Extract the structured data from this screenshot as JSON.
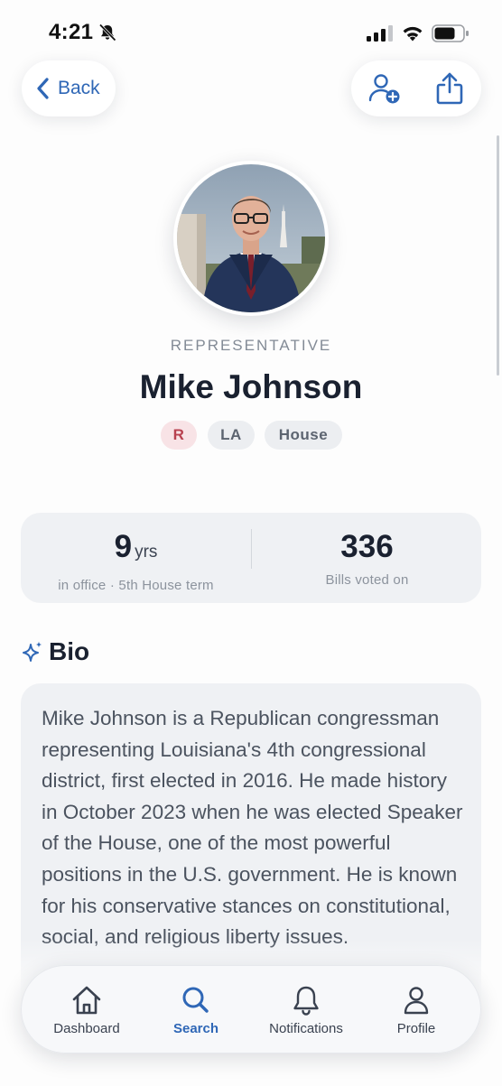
{
  "status_bar": {
    "time": "4:21"
  },
  "nav": {
    "back_label": "Back"
  },
  "member": {
    "role": "REPRESENTATIVE",
    "name": "Mike Johnson",
    "tags": {
      "party": "R",
      "state": "LA",
      "chamber": "House"
    }
  },
  "stats": {
    "tenure_value": "9",
    "tenure_unit": "yrs",
    "tenure_caption": "in office · 5th House term",
    "bills_value": "336",
    "bills_caption": "Bills voted on"
  },
  "bio": {
    "title": "Bio",
    "text": "Mike Johnson is a Republican congressman representing Louisiana's 4th congressional district, first elected in 2016. He made history in October 2023 when he was elected Speaker of the House, one of the most powerful positions in the U.S. government. He is known for his conservative stances on constitutional, social, and religious liberty issues."
  },
  "tab_bar": {
    "active": "Search",
    "tabs": {
      "dashboard": "Dashboard",
      "search": "Search",
      "notifications": "Notifications",
      "profile": "Profile"
    }
  },
  "colors": {
    "accent": "#2f67b6",
    "party_republican_bg": "#f8e3e6",
    "party_republican_text": "#b8414f",
    "card_bg": "#eff1f4"
  },
  "icons": [
    "bell-muted-icon",
    "signal-icon",
    "wifi-icon",
    "battery-icon",
    "chevron-left-icon",
    "add-person-icon",
    "share-icon",
    "sparkle-icon",
    "home-icon",
    "search-icon",
    "bell-icon",
    "person-icon"
  ]
}
